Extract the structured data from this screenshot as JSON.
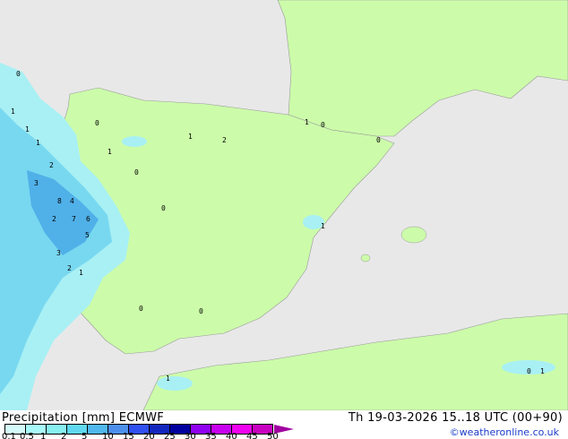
{
  "title": {
    "label": "Precipitation [mm]",
    "model": "ECMWF"
  },
  "date": "Th 19-03-2026 15..18 UTC (00+90)",
  "credit": "©weatheronline.co.uk",
  "legend": {
    "ticks": [
      "0.1",
      "0.5",
      "1",
      "2",
      "5",
      "10",
      "15",
      "20",
      "25",
      "30",
      "35",
      "40",
      "45",
      "50"
    ],
    "colors": [
      "#d4fafa",
      "#a8fafa",
      "#88f0f0",
      "#60d8f0",
      "#50b8ec",
      "#4c90ec",
      "#3050f0",
      "#1428c0",
      "#0000a0",
      "#9000f0",
      "#c800f0",
      "#f000f0",
      "#c800c0"
    ]
  },
  "colors": {
    "sea": "#e8e8e8",
    "land": "#ccfcaa",
    "rain_light": "#a8f0f4",
    "rain_mid": "#78d8f0",
    "rain_heavy": "#50b0e8"
  },
  "map_values": [
    "0",
    "1",
    "2",
    "3",
    "4",
    "5",
    "6",
    "7",
    "8",
    "1",
    "1",
    "2",
    "3",
    "2",
    "1",
    "0",
    "1",
    "0",
    "0",
    "1",
    "2",
    "1",
    "0",
    "0",
    "1",
    "0",
    "0",
    "1",
    "0",
    "1"
  ]
}
